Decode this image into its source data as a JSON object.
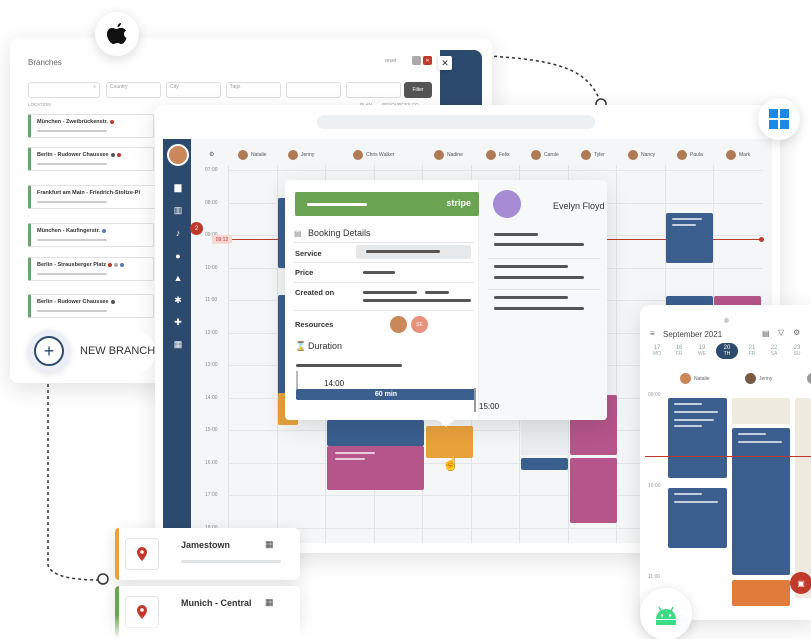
{
  "branches_panel": {
    "title": "Branches",
    "filter_labels": {
      "country": "Country",
      "city": "City",
      "tags": "Tags"
    },
    "filter_button": "Filter",
    "column_location": "LOCATION",
    "column_plan": "PLAN",
    "column_resources": "RESOURCES CO...",
    "reset": "reset",
    "rows": [
      {
        "name": "München - Zweibrückenstr.",
        "dots": [
          "#c0392b"
        ]
      },
      {
        "name": "Berlin - Rudower Chaussee",
        "dots": [
          "#555",
          "#c0392b"
        ]
      },
      {
        "name": "Frankfurt am Main - Friedrich-Stoltze-Pl",
        "dots": []
      },
      {
        "name": "München - Kaufingerstr.",
        "dots": [
          "#5a7bbf"
        ]
      },
      {
        "name": "Berlin - Strausberger Platz",
        "dots": [
          "#c0392b",
          "#aaa",
          "#5a7bbf"
        ]
      },
      {
        "name": "Berlin - Rudower Chaussee",
        "dots": [
          "#555"
        ]
      }
    ],
    "new_branch": "NEW BRANCH"
  },
  "calendar": {
    "staff": [
      "Natalie",
      "Jenny",
      "Chris Walker",
      "Nadine",
      "Felix",
      "Carole",
      "Tyler",
      "Nancy",
      "Paula",
      "Mark"
    ],
    "times": [
      "07:00",
      "08:00",
      "09:00",
      "10:00",
      "11:00",
      "12:00",
      "13:00",
      "14:00",
      "15:00",
      "16:00",
      "17:00",
      "18:00"
    ],
    "now_label": "09:12",
    "notification_count": "2"
  },
  "popup": {
    "provider": "stripe",
    "customer": "Evelyn Floyd",
    "booking_details": "Booking Details",
    "service_label": "Service",
    "price_label": "Price",
    "created_on_label": "Created on",
    "resources_label": "Resources",
    "resource_badge": "SE",
    "duration_label": "Duration",
    "start_time": "14:00",
    "duration_value": "60 min",
    "end_time": "15:00"
  },
  "mobile": {
    "month": "September 2021",
    "days": [
      {
        "num": "17",
        "wd": "MO"
      },
      {
        "num": "18",
        "wd": "FR"
      },
      {
        "num": "19",
        "wd": "WE"
      },
      {
        "num": "20",
        "wd": "TH"
      },
      {
        "num": "21",
        "wd": "FR"
      },
      {
        "num": "22",
        "wd": "SA"
      },
      {
        "num": "23",
        "wd": "SU"
      }
    ],
    "staff": [
      "Natalie",
      "Jenny"
    ],
    "times": [
      "09:00",
      "10:00",
      "11:00"
    ]
  },
  "locations": [
    {
      "name": "Jamestown"
    },
    {
      "name": "Munich - Central"
    }
  ],
  "colors": {
    "navy": "#2c4a6e",
    "green": "#6aa351",
    "pink": "#b5558a",
    "orange": "#e8a23c",
    "blue": "#3a5f8f",
    "red": "#c0392b"
  }
}
